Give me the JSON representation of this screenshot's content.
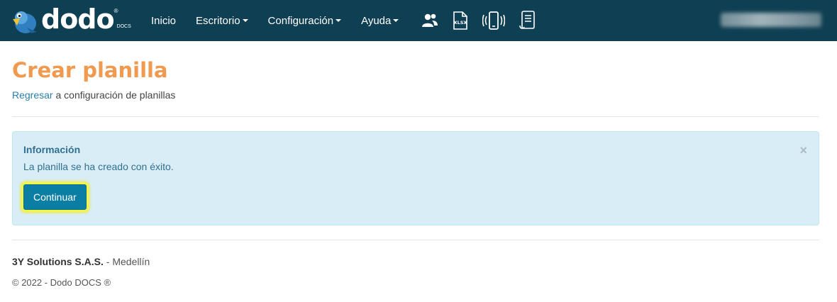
{
  "nav": {
    "brand": "dodo",
    "brand_mark": "®",
    "brand_sub": "DOCS",
    "items": [
      {
        "label": "Inicio"
      },
      {
        "label": "Escritorio"
      },
      {
        "label": "Configuración"
      },
      {
        "label": "Ayuda"
      }
    ],
    "icons": [
      "users-icon",
      "xlsx-file-icon",
      "mobile-vibrate-icon",
      "document-list-icon"
    ],
    "xlsx_label": "XLSX"
  },
  "page": {
    "title": "Crear planilla",
    "back_link": "Regresar",
    "back_text": " a configuración de planillas"
  },
  "alert": {
    "title": "Información",
    "message": "La planilla se ha creado con éxito.",
    "close": "×",
    "button": "Continuar"
  },
  "footer": {
    "company": "3Y Solutions S.A.S.",
    "city": " - Medellín",
    "copyright": "© 2022 - Dodo DOCS ®"
  },
  "colors": {
    "navbar": "#0f3f52",
    "title": "#ef9a4e",
    "link": "#2a7fa6",
    "alert_bg": "#d9edf7",
    "button": "#0b7fa3",
    "highlight": "#f3f54a"
  }
}
